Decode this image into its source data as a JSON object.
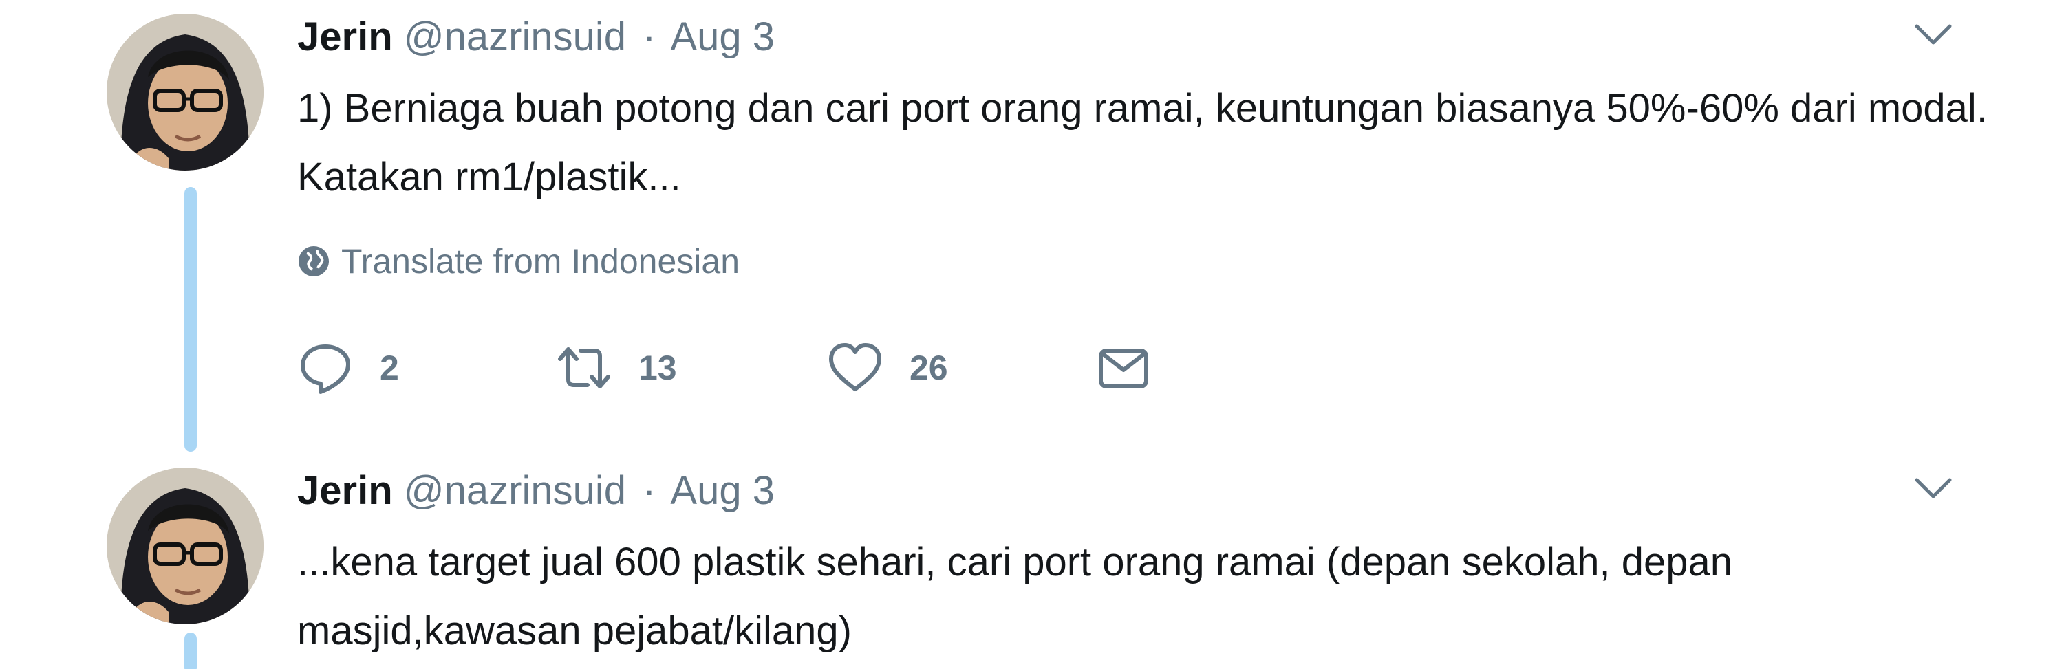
{
  "tweets": [
    {
      "author_name": "Jerin",
      "handle": "@nazrinsuid",
      "separator": "·",
      "date": "Aug 3",
      "text": "1) Berniaga buah potong dan cari port orang ramai, keuntungan biasanya 50%-60% dari modal. Katakan rm1/plastik...",
      "translate_label": "Translate from Indonesian",
      "reply_count": "2",
      "retweet_count": "13",
      "like_count": "26"
    },
    {
      "author_name": "Jerin",
      "handle": "@nazrinsuid",
      "separator": "·",
      "date": "Aug 3",
      "text": "...kena target jual 600 plastik sehari, cari port orang ramai (depan sekolah, depan masjid,kawasan pejabat/kilang)"
    }
  ],
  "icons": {
    "caret": "chevron-down-icon",
    "globe": "globe-icon",
    "reply": "reply-icon",
    "retweet": "retweet-icon",
    "like": "heart-icon",
    "dm": "envelope-icon"
  },
  "colors": {
    "text_primary": "#14171a",
    "text_secondary": "#657786",
    "thread_line": "#a9d6f5",
    "background": "#ffffff"
  }
}
